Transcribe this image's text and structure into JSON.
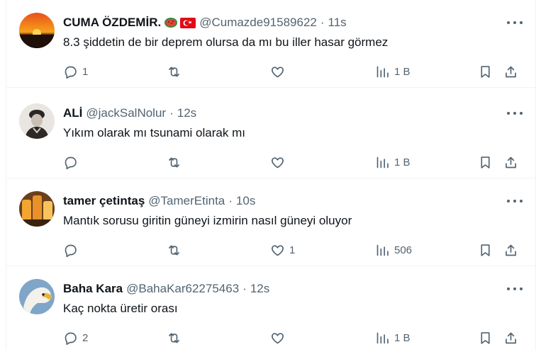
{
  "tweets": [
    {
      "name": "CUMA ÖZDEMİR.",
      "handle": "@Cumazde91589622",
      "time": "11s",
      "text": "8.3 şiddetin de bir deprem olursa da mı bu iller hasar görmez",
      "replies": "1",
      "retweets": "",
      "likes": "",
      "views": "1 B",
      "name_icons": [
        "watermelon-icon",
        "turkey-flag-icon"
      ]
    },
    {
      "name": "ALİ",
      "handle": "@jackSalNolur",
      "time": "12s",
      "text": "Yıkım olarak mı tsunami olarak mı",
      "replies": "",
      "retweets": "",
      "likes": "",
      "views": "1 B"
    },
    {
      "name": "tamer çetintaş",
      "handle": "@TamerEtinta",
      "time": "10s",
      "text": "Mantık sorusu giritin güneyi izmirin nasıl güneyi oluyor",
      "replies": "",
      "retweets": "",
      "likes": "1",
      "views": "506"
    },
    {
      "name": "Baha Kara",
      "handle": "@BahaKar62275463",
      "time": "12s",
      "text": "Kaç nokta üretir orası",
      "replies": "2",
      "retweets": "",
      "likes": "",
      "views": "1 B"
    }
  ],
  "separator": "·",
  "colors": {
    "text": "#0f1419",
    "muted": "#536471",
    "border": "#eff3f4"
  }
}
